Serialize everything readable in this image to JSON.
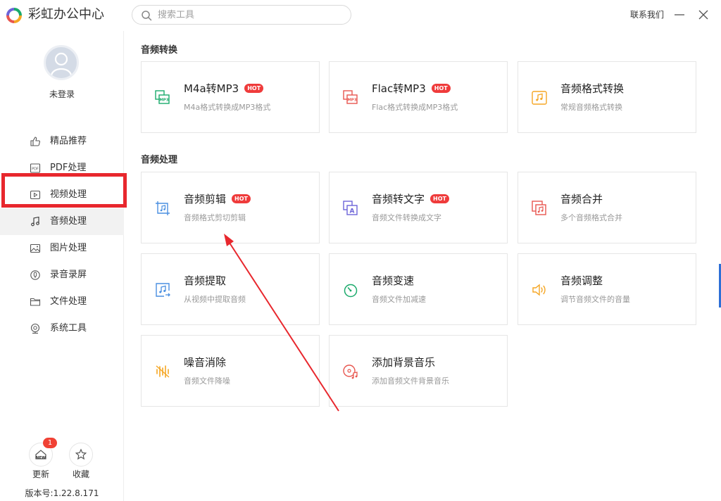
{
  "app": {
    "title": "彩虹办公中心"
  },
  "search": {
    "placeholder": "搜索工具"
  },
  "header": {
    "contact": "联系我们"
  },
  "user": {
    "login_status": "未登录"
  },
  "sidebar": {
    "items": [
      {
        "label": "精品推荐",
        "icon": "thumbs-up-icon"
      },
      {
        "label": "PDF处理",
        "icon": "pdf-icon"
      },
      {
        "label": "视频处理",
        "icon": "video-icon"
      },
      {
        "label": "音频处理",
        "icon": "music-note-icon",
        "active": true
      },
      {
        "label": "图片处理",
        "icon": "image-icon"
      },
      {
        "label": "录音录屏",
        "icon": "record-icon"
      },
      {
        "label": "文件处理",
        "icon": "folder-icon"
      },
      {
        "label": "系统工具",
        "icon": "system-tool-icon"
      }
    ],
    "update_label": "更新",
    "update_badge": "1",
    "update_icon_text": "NEW",
    "favorite_label": "收藏",
    "version": "版本号:1.22.8.171"
  },
  "sections": [
    {
      "title": "音频转换",
      "cards": [
        {
          "title": "M4a转MP3",
          "hot": true,
          "desc": "M4a格式转换成MP3格式",
          "icon": "m4a-to-mp3-icon",
          "icon_text": "MP3",
          "color": "#1aaa6b"
        },
        {
          "title": "Flac转MP3",
          "hot": true,
          "desc": "Flac格式转换成MP3格式",
          "icon": "flac-to-mp3-icon",
          "icon_text": "MP3",
          "color": "#e8564f"
        },
        {
          "title": "音频格式转换",
          "hot": false,
          "desc": "常规音频格式转换",
          "icon": "audio-convert-icon",
          "color": "#f5a623"
        }
      ]
    },
    {
      "title": "音频处理",
      "cards": [
        {
          "title": "音频剪辑",
          "hot": true,
          "desc": "音频格式剪切剪辑",
          "icon": "audio-cut-icon",
          "color": "#4a8fe0"
        },
        {
          "title": "音频转文字",
          "hot": true,
          "desc": "音频文件转换成文字",
          "icon": "audio-to-text-icon",
          "icon_text": "A",
          "color": "#6c63d8"
        },
        {
          "title": "音频合并",
          "hot": false,
          "desc": "多个音频格式合并",
          "icon": "audio-merge-icon",
          "color": "#e8564f"
        },
        {
          "title": "音频提取",
          "hot": false,
          "desc": "从视频中提取音频",
          "icon": "audio-extract-icon",
          "color": "#4a8fe0"
        },
        {
          "title": "音频变速",
          "hot": false,
          "desc": "音频文件加减速",
          "icon": "audio-speed-icon",
          "color": "#1aaa6b"
        },
        {
          "title": "音频调整",
          "hot": false,
          "desc": "调节音频文件的音量",
          "icon": "volume-icon",
          "color": "#f5a623"
        },
        {
          "title": "噪音消除",
          "hot": false,
          "desc": "音频文件降噪",
          "icon": "noise-reduce-icon",
          "color": "#f5a623"
        },
        {
          "title": "添加背景音乐",
          "hot": false,
          "desc": "添加音频文件背景音乐",
          "icon": "bg-music-icon",
          "color": "#e8564f"
        }
      ]
    }
  ],
  "hot_label": "HOT",
  "colors": {
    "highlight": "#e8272d",
    "hot": "#ef3b3b",
    "annotation_arrow": "#e8272d"
  }
}
